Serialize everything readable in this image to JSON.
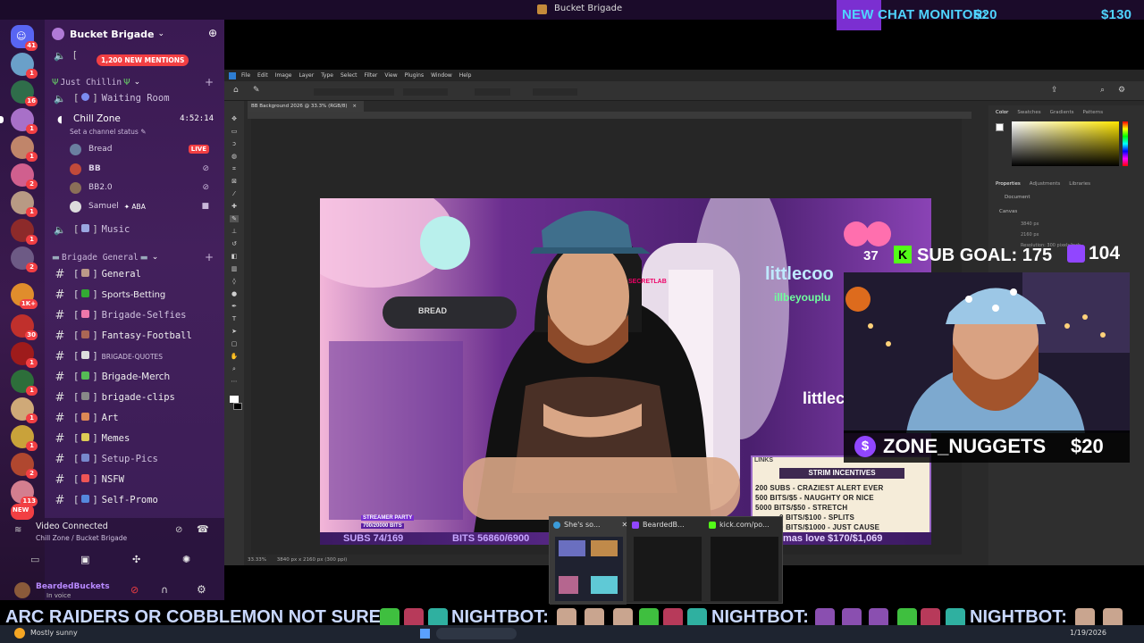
{
  "window": {
    "title": "Bucket Brigade"
  },
  "chat_monitor": {
    "label": "NEW CHAT MONITOR:",
    "amount1": "$20",
    "amount2": "$130"
  },
  "server": {
    "name": "Bucket Brigade",
    "mentions": "1,200 NEW MENTIONS",
    "badges": [
      "41",
      "1",
      "16",
      "1",
      "1",
      "2",
      "1",
      "1",
      "2",
      "1K+",
      "30",
      "1",
      "1",
      "1",
      "1",
      "2",
      "113",
      "1",
      "NEW"
    ]
  },
  "categories": {
    "chillin": "Just Chillin",
    "general": "Brigade General"
  },
  "voice_channels": {
    "waiting_room": "Waiting Room",
    "chill_zone": "Chill Zone",
    "chill_zone_time": "4:52:14",
    "channel_status": "Set a channel status",
    "music": "Music"
  },
  "voice_users": [
    {
      "name": "Bread",
      "tag": "LIVE"
    },
    {
      "name": "BB"
    },
    {
      "name": "BB2.0"
    },
    {
      "name": "Samuel",
      "tag": "ABA"
    }
  ],
  "text_channels": [
    "General",
    "Sports-Betting",
    "Brigade-Selfies",
    "Fantasy-Football",
    "BRIGADE-QUOTES",
    "Brigade-Merch",
    "brigade-clips",
    "Art",
    "Memes",
    "Setup-Pics",
    "NSFW",
    "Self-Promo"
  ],
  "voice_panel": {
    "status": "Video Connected",
    "location": "Chill Zone / Bucket Brigade"
  },
  "user_panel": {
    "username": "BeardedBuckets",
    "status": "In voice"
  },
  "photoshop": {
    "menu": [
      "File",
      "Edit",
      "Image",
      "Layer",
      "Type",
      "Select",
      "Filter",
      "View",
      "Plugins",
      "Window",
      "Help"
    ],
    "doc_tab": "BB Background 2026 @ 33.3% (RGB/8)",
    "zoom": "33.33%",
    "doc_size": "3840 px x 2160 px (300 ppi)",
    "right_tabs1": [
      "Color",
      "Swatches",
      "Gradients",
      "Patterns"
    ],
    "right_tabs2": [
      "Properties",
      "Adjustments",
      "Libraries"
    ],
    "props": {
      "document": "Document",
      "canvas": "Canvas",
      "w": "3840 px",
      "h": "2160 px",
      "resolution": "Resolution: 300 pixels/inch"
    }
  },
  "stream": {
    "sign_text1": "littlecoo",
    "sign_text2": "illbeyouplu",
    "sign_text3": "littleco",
    "mic_label": "BREAD",
    "chair_label": "SECRETLAB",
    "subs_bar": "SUBS 74/169",
    "bits_bar": "BITS 56860/6900",
    "xmas_bar": "mas love $170/$1,069",
    "streamer_party": "STREAMER PARTY",
    "sub_goal_small": "700/20000 BITS"
  },
  "incentives": {
    "links": "LINKS",
    "title": "STRIM INCENTIVES",
    "lines": [
      "200 SUBS - CRAZIEST ALERT EVER",
      "500 BITS/$5 - NAUGHTY OR NICE",
      "5000 BITS/$50 - STRETCH",
      "0 BITS/$100 - SPLITS",
      "0 BITS/$1000 - JUST CAUSE"
    ]
  },
  "overlay": {
    "sub_count_left": "37",
    "sub_goal": "SUB GOAL: 175",
    "viewer_count": "104",
    "donor": "ZONE_NUGGETS",
    "donation": "$20"
  },
  "previews": [
    {
      "title": "She's so...",
      "icon_color": "#3ba55c"
    },
    {
      "title": "BeardedB...",
      "icon_color": "#9146ff"
    },
    {
      "title": "kick.com/po...",
      "icon_color": "#53fc18"
    }
  ],
  "ticker": {
    "text1": "ARC RAIDERS OR COBBLEMON NOT SURE",
    "bot": "NIGHTBOT:"
  },
  "taskbar": {
    "weather": "Mostly sunny",
    "date": "1/19/2026"
  }
}
